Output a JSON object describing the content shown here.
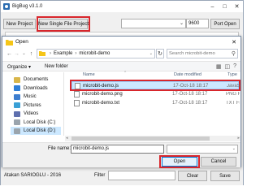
{
  "app": {
    "title": "BigBug v3.1.0",
    "toolbar": {
      "new_project": "New Project",
      "new_single_file_project": "New Single File Project",
      "port_value": "9600",
      "port_open": "Port Open"
    },
    "status": {
      "author": "Atakan SARIOGLU - 2016",
      "filter_label": "Filter",
      "clear": "Clear",
      "save": "Save"
    }
  },
  "dialog": {
    "title": "Open",
    "breadcrumb": [
      "Example",
      "microbit-demo"
    ],
    "search_placeholder": "Search microbit-demo",
    "organize": "Organize",
    "new_folder": "New folder",
    "nav_items": [
      {
        "label": "Documents",
        "icon": "documents-icon",
        "color": "#d9b64a"
      },
      {
        "label": "Downloads",
        "icon": "downloads-icon",
        "color": "#2f7fd7"
      },
      {
        "label": "Music",
        "icon": "music-icon",
        "color": "#3d7ecf"
      },
      {
        "label": "Pictures",
        "icon": "pictures-icon",
        "color": "#3aa0d6"
      },
      {
        "label": "Videos",
        "icon": "videos-icon",
        "color": "#5e6fae"
      },
      {
        "label": "Local Disk (C:)",
        "icon": "drive-icon",
        "color": "#9aa4ad"
      },
      {
        "label": "Local Disk (D:)",
        "icon": "drive-icon",
        "color": "#9aa4ad"
      }
    ],
    "columns": {
      "name": "Name",
      "date": "Date modified",
      "type": "Type"
    },
    "files": [
      {
        "name": "microbit-demo.js",
        "date": "17-Oct-18 18:17",
        "type": "JavaScript"
      },
      {
        "name": "microbit-demo.png",
        "date": "17-Oct-18 18:17",
        "type": "PNG File"
      },
      {
        "name": "microbit-demo.txt",
        "date": "17-Oct-18 18:17",
        "type": "TXT File"
      }
    ],
    "file_name_label": "File name:",
    "file_name_value": "microbit-demo.js",
    "open": "Open",
    "cancel": "Cancel"
  }
}
